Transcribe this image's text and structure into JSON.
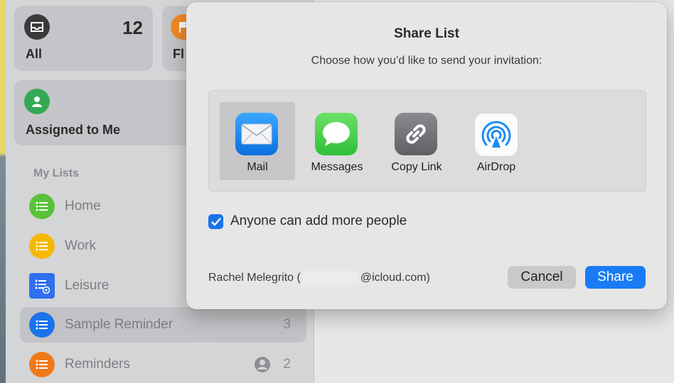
{
  "sidebar": {
    "smart_lists": [
      {
        "label": "All",
        "count": "12",
        "color": "#3a3a3c"
      },
      {
        "label": "Fl",
        "color": "#f08a24"
      },
      {
        "label": "Assigned to Me",
        "color": "#34a853"
      }
    ],
    "section_title": "My Lists",
    "lists": [
      {
        "label": "Home",
        "count": "",
        "color": "#5ac23a",
        "icon": "list-icon"
      },
      {
        "label": "Work",
        "count": "",
        "color": "#f5b800",
        "icon": "list-icon"
      },
      {
        "label": "Leisure",
        "count": "",
        "color": "#2f6ff0",
        "icon": "shared-list-icon"
      },
      {
        "label": "Sample Reminder",
        "count": "3",
        "color": "#1a73e8",
        "icon": "list-icon",
        "selected": true
      },
      {
        "label": "Reminders",
        "count": "2",
        "color": "#f07a1a",
        "icon": "list-icon",
        "shared": true
      }
    ]
  },
  "dialog": {
    "title": "Share List",
    "subtitle": "Choose how you’d like to send your invitation:",
    "options": [
      {
        "label": "Mail",
        "icon": "mail-icon",
        "selected": true
      },
      {
        "label": "Messages",
        "icon": "messages-icon"
      },
      {
        "label": "Copy Link",
        "icon": "link-icon"
      },
      {
        "label": "AirDrop",
        "icon": "airdrop-icon"
      }
    ],
    "checkbox_label": "Anyone can add more people",
    "checkbox_checked": true,
    "account_name": "Rachel Melegrito (",
    "account_suffix": "@icloud.com)",
    "cancel_label": "Cancel",
    "share_label": "Share"
  }
}
